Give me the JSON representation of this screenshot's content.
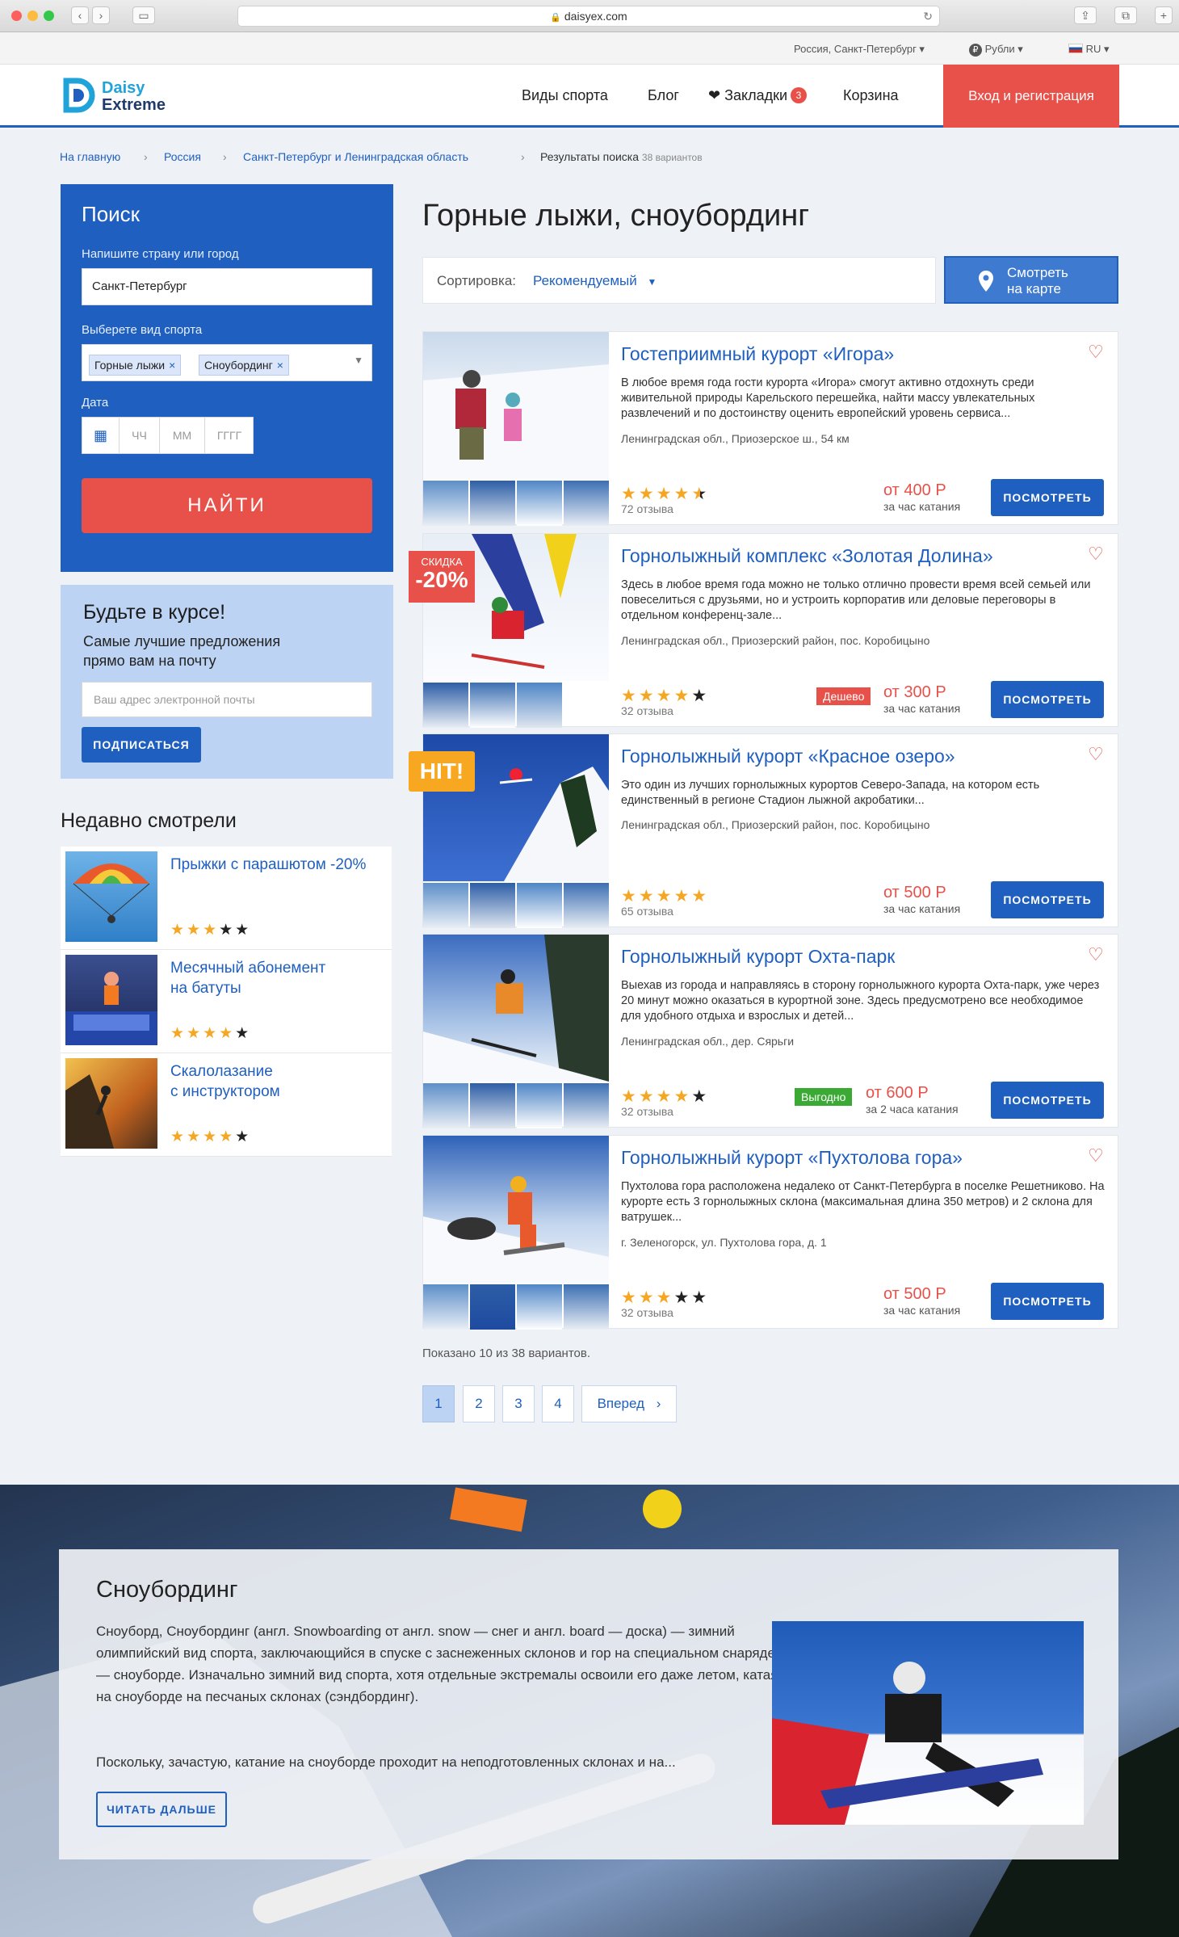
{
  "browser": {
    "url": "daisyex.com"
  },
  "topbar": {
    "location": "Россия, Санкт-Петербург",
    "currency": "Рубли",
    "language": "RU"
  },
  "header": {
    "logo_top": "Daisy",
    "logo_bottom": "Extreme",
    "nav": [
      "Виды спорта",
      "Блог",
      "Закладки",
      "Корзина"
    ],
    "bookmarks_count": "3",
    "login": "Вход и регистрация"
  },
  "breadcrumb": {
    "items": [
      "На главную",
      "Россия",
      "Санкт-Петербург и Ленинградская область"
    ],
    "current": "Результаты поиска",
    "count": "38 вариантов"
  },
  "search": {
    "title": "Поиск",
    "city_label": "Напишите страну или город",
    "city_value": "Санкт-Петербург",
    "sport_label": "Выберете вид спорта",
    "sport_tags": [
      "Горные лыжи",
      "Сноубординг"
    ],
    "date_label": "Дата",
    "date_hh": "ЧЧ",
    "date_mm": "ММ",
    "date_yy": "ГГГГ",
    "button": "НАЙТИ"
  },
  "newsletter": {
    "title": "Будьте в курсе!",
    "text1": "Самые лучшие предложения",
    "text2": "прямо вам на почту",
    "placeholder": "Ваш адрес электронной почты",
    "button": "ПОДПИСАТЬСЯ"
  },
  "recent": {
    "title": "Недавно смотрели",
    "items": [
      {
        "line1": "Прыжки с парашютом -20%",
        "line2": "",
        "rating": 3
      },
      {
        "line1": "Месячный абонемент",
        "line2": "на батуты",
        "rating": 4
      },
      {
        "line1": "Скалолазание",
        "line2": "с инструктором",
        "rating": 4
      }
    ]
  },
  "results": {
    "title": "Горные лыжи, сноубординг",
    "sort_label": "Сортировка:",
    "sort_value": "Рекомендуемый",
    "map_line1": "Смотреть",
    "map_line2": "на карте",
    "look_button": "ПОСМОТРЕТЬ",
    "discount_label": "СКИДКА",
    "discount_value": "-20%",
    "hit_label": "HIT!",
    "items": [
      {
        "title": "Гостеприимный курорт «Игора»",
        "desc": "В любое время года гости курорта «Игора» смогут активно отдохнуть среди живительной природы Карельского перешейка, найти массу увлекательных развлечений и по достоинству оценить европейский уровень сервиса...",
        "location": "Ленинградская обл., Приозерское ш., 54 км",
        "rating": 4.5,
        "reviews": "72 отзыва",
        "price": "от 400 Р",
        "unit": "за час катания",
        "tag": ""
      },
      {
        "title": "Горнолыжный комплекс «Золотая Долина»",
        "desc": "Здесь в любое время года можно не только отлично провести время всей семьей или повеселиться с друзьями, но и устроить корпоратив или деловые переговоры в отдельном конференц-зале...",
        "location": "Ленинградская обл., Приозерский район, пос. Коробицыно",
        "rating": 4,
        "reviews": "32 отзыва",
        "price": "от 300 Р",
        "unit": "за час катания",
        "tag": "Дешево"
      },
      {
        "title": "Горнолыжный курорт «Красное озеро»",
        "desc": "Это один из лучших горнолыжных курортов Северо-Запада, на котором есть единственный в регионе Стадион лыжной акробатики...",
        "location": "Ленинградская обл., Приозерский район, пос. Коробицыно",
        "rating": 5,
        "reviews": "65 отзыва",
        "price": "от 500 Р",
        "unit": "за час катания",
        "tag": ""
      },
      {
        "title": "Горнолыжный курорт Охта-парк",
        "desc": "Выехав из города и направляясь в сторону горнолыжного курорта Охта-парк, уже через 20 минут можно оказаться в курортной зоне. Здесь предусмотрено все необходимое для удобного отдыха и взрослых и детей...",
        "location": "Ленинградская обл., дер. Сярьги",
        "rating": 4,
        "reviews": "32 отзыва",
        "price": "от 600 Р",
        "unit": "за 2 часа катания",
        "tag": "Выгодно"
      },
      {
        "title": "Горнолыжный курорт «Пухтолова гора»",
        "desc": "Пухтолова гора расположена недалеко от Санкт-Петербурга в поселке Решетниково. На курорте есть 3 горнолыжных склона (максимальная длина 350 метров) и 2 склона для ватрушек...",
        "location": "г. Зеленогорск, ул. Пухтолова гора, д. 1",
        "rating": 3,
        "reviews": "32 отзыва",
        "price": "от 500 Р",
        "unit": "за час катания",
        "tag": ""
      }
    ],
    "shown": "Показано 10 из 38 вариантов.",
    "pages": [
      "1",
      "2",
      "3",
      "4"
    ],
    "next": "Вперед"
  },
  "info": {
    "title": "Сноубординг",
    "p1": "Сноуборд, Сноубординг (англ. Snowboarding от англ. snow — снег и англ. board — доска) — зимний олимпийский вид спорта, заключающийся в спуске с заснеженных склонов и гор на специальном снаряде — сноуборде. Изначально зимний вид спорта, хотя отдельные экстремалы освоили его даже летом, катаясь на сноуборде на песчаных склонах (сэндбординг).",
    "p2": "Поскольку, зачастую, катание на сноуборде проходит на неподготовленных склонах и на...",
    "button": "ЧИТАТЬ ДАЛЬШЕ"
  },
  "colors": {
    "brand": "#1f5fbf",
    "accent": "#e8514a",
    "star": "#f5a623",
    "hit": "#f7a820",
    "good": "#3aaa35"
  }
}
